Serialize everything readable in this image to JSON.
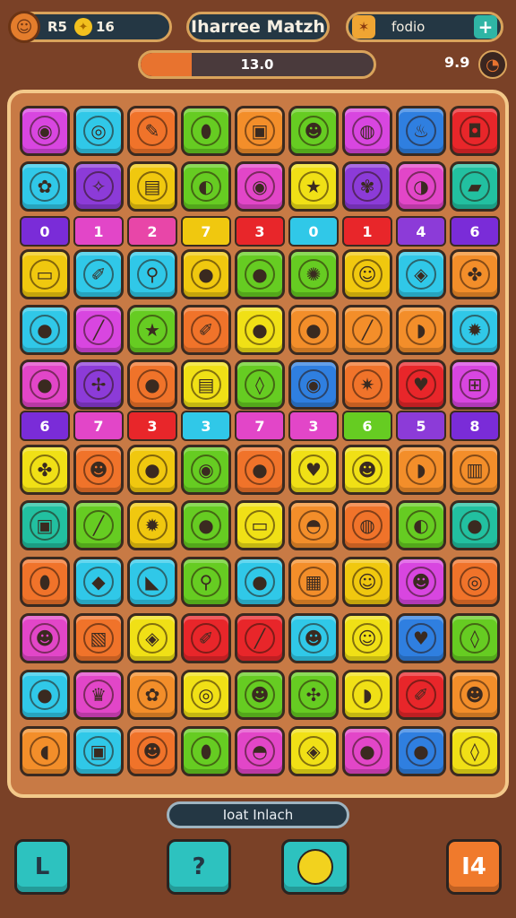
{
  "hud": {
    "left_label": "R5",
    "coins": "16",
    "title": "Iharree Matzh",
    "right_label": "fodio",
    "side_value": "9.9"
  },
  "progress": {
    "text": "13.0",
    "fraction": 0.22
  },
  "bottom_label": "Ioat Inlach",
  "buttons": {
    "a": "L",
    "b": "?",
    "d": "I4"
  },
  "board": {
    "rows": [
      {
        "kind": "tiles",
        "tiles": [
          {
            "c": "#d846e0",
            "g": "◉"
          },
          {
            "c": "#30c8e8",
            "g": "◎"
          },
          {
            "c": "#f0732a",
            "g": "✎"
          },
          {
            "c": "#66cc22",
            "g": "⬮"
          },
          {
            "c": "#f38e2a",
            "g": "▣"
          },
          {
            "c": "#66cc22",
            "g": "☻"
          },
          {
            "c": "#d846e0",
            "g": "◍"
          },
          {
            "c": "#2f7fe0",
            "g": "♨"
          },
          {
            "c": "#e8262a",
            "g": "◘"
          }
        ]
      },
      {
        "kind": "tiles",
        "tiles": [
          {
            "c": "#30c8e8",
            "g": "✿"
          },
          {
            "c": "#8c3bd8",
            "g": "✧"
          },
          {
            "c": "#f0c80f",
            "g": "▤"
          },
          {
            "c": "#66cc22",
            "g": "◐"
          },
          {
            "c": "#e246c8",
            "g": "◉"
          },
          {
            "c": "#f0e016",
            "g": "★"
          },
          {
            "c": "#8c3bd8",
            "g": "✾"
          },
          {
            "c": "#e246c8",
            "g": "◑"
          },
          {
            "c": "#22c0a0",
            "g": "▰"
          }
        ]
      },
      {
        "kind": "nums",
        "tiles": [
          {
            "c": "#7a2cd8",
            "n": "0"
          },
          {
            "c": "#e246c8",
            "n": "1"
          },
          {
            "c": "#e846a8",
            "n": "2"
          },
          {
            "c": "#f0c80f",
            "n": "7"
          },
          {
            "c": "#e8262a",
            "n": "3"
          },
          {
            "c": "#30c8e8",
            "n": "0"
          },
          {
            "c": "#e8262a",
            "n": "1"
          },
          {
            "c": "#8c3bd8",
            "n": "4"
          },
          {
            "c": "#7a2cd8",
            "n": "6"
          }
        ]
      },
      {
        "kind": "tiles",
        "tiles": [
          {
            "c": "#f0c80f",
            "g": "▭"
          },
          {
            "c": "#30c8e8",
            "g": "✐"
          },
          {
            "c": "#30c8e8",
            "g": "⚲"
          },
          {
            "c": "#f0c80f",
            "g": "●"
          },
          {
            "c": "#66cc22",
            "g": "●"
          },
          {
            "c": "#66cc22",
            "g": "✺"
          },
          {
            "c": "#f0c80f",
            "g": "☺"
          },
          {
            "c": "#30c8e8",
            "g": "◈"
          },
          {
            "c": "#f38e2a",
            "g": "✤"
          }
        ]
      },
      {
        "kind": "tiles",
        "tiles": [
          {
            "c": "#30c8e8",
            "g": "●"
          },
          {
            "c": "#d846e0",
            "g": "╱"
          },
          {
            "c": "#66cc22",
            "g": "★"
          },
          {
            "c": "#f0732a",
            "g": "✐"
          },
          {
            "c": "#f0e016",
            "g": "●"
          },
          {
            "c": "#f38e2a",
            "g": "●"
          },
          {
            "c": "#f38e2a",
            "g": "╱"
          },
          {
            "c": "#f38e2a",
            "g": "◗"
          },
          {
            "c": "#30c8e8",
            "g": "✹"
          }
        ]
      },
      {
        "kind": "tiles",
        "tiles": [
          {
            "c": "#e246c8",
            "g": "●"
          },
          {
            "c": "#8c3bd8",
            "g": "✢"
          },
          {
            "c": "#f0732a",
            "g": "●"
          },
          {
            "c": "#f0e016",
            "g": "▤"
          },
          {
            "c": "#66cc22",
            "g": "◊"
          },
          {
            "c": "#2f7fe0",
            "g": "◉"
          },
          {
            "c": "#f0732a",
            "g": "✷"
          },
          {
            "c": "#e8262a",
            "g": "♥"
          },
          {
            "c": "#d846e0",
            "g": "⊞"
          }
        ]
      },
      {
        "kind": "nums",
        "tiles": [
          {
            "c": "#7a2cd8",
            "n": "6"
          },
          {
            "c": "#e246c8",
            "n": "7"
          },
          {
            "c": "#e8262a",
            "n": "3"
          },
          {
            "c": "#30c8e8",
            "n": "3"
          },
          {
            "c": "#e246c8",
            "n": "7"
          },
          {
            "c": "#e246c8",
            "n": "3"
          },
          {
            "c": "#66cc22",
            "n": "6"
          },
          {
            "c": "#8c3bd8",
            "n": "5"
          },
          {
            "c": "#7a2cd8",
            "n": "8"
          }
        ]
      },
      {
        "kind": "tiles",
        "tiles": [
          {
            "c": "#f0e016",
            "g": "✤"
          },
          {
            "c": "#f0732a",
            "g": "☻"
          },
          {
            "c": "#f0c80f",
            "g": "●"
          },
          {
            "c": "#66cc22",
            "g": "◉"
          },
          {
            "c": "#f0732a",
            "g": "●"
          },
          {
            "c": "#f0e016",
            "g": "♥"
          },
          {
            "c": "#f0e016",
            "g": "☻"
          },
          {
            "c": "#f38e2a",
            "g": "◗"
          },
          {
            "c": "#f38e2a",
            "g": "▥"
          }
        ]
      },
      {
        "kind": "tiles",
        "tiles": [
          {
            "c": "#22c0a0",
            "g": "▣"
          },
          {
            "c": "#66cc22",
            "g": "╱"
          },
          {
            "c": "#f0c80f",
            "g": "✹"
          },
          {
            "c": "#66cc22",
            "g": "●"
          },
          {
            "c": "#f0e016",
            "g": "▭"
          },
          {
            "c": "#f38e2a",
            "g": "◓"
          },
          {
            "c": "#f0732a",
            "g": "◍"
          },
          {
            "c": "#66cc22",
            "g": "◐"
          },
          {
            "c": "#22c0a0",
            "g": "●"
          }
        ]
      },
      {
        "kind": "tiles",
        "tiles": [
          {
            "c": "#f0732a",
            "g": "⬮"
          },
          {
            "c": "#30c8e8",
            "g": "◆"
          },
          {
            "c": "#30c8e8",
            "g": "◣"
          },
          {
            "c": "#66cc22",
            "g": "⚲"
          },
          {
            "c": "#30c8e8",
            "g": "●"
          },
          {
            "c": "#f38e2a",
            "g": "▦"
          },
          {
            "c": "#f0c80f",
            "g": "☺"
          },
          {
            "c": "#d846e0",
            "g": "☻"
          },
          {
            "c": "#f0732a",
            "g": "◎"
          }
        ]
      },
      {
        "kind": "tiles",
        "tiles": [
          {
            "c": "#e246c8",
            "g": "☻"
          },
          {
            "c": "#f0732a",
            "g": "▧"
          },
          {
            "c": "#f0e016",
            "g": "◈"
          },
          {
            "c": "#e8262a",
            "g": "✐"
          },
          {
            "c": "#e8262a",
            "g": "╱"
          },
          {
            "c": "#30c8e8",
            "g": "☻"
          },
          {
            "c": "#f0e016",
            "g": "☺"
          },
          {
            "c": "#2f7fe0",
            "g": "♥"
          },
          {
            "c": "#66cc22",
            "g": "◊"
          }
        ]
      },
      {
        "kind": "tiles",
        "tiles": [
          {
            "c": "#30c8e8",
            "g": "●"
          },
          {
            "c": "#e246c8",
            "g": "♛"
          },
          {
            "c": "#f38e2a",
            "g": "✿"
          },
          {
            "c": "#f0e016",
            "g": "◎"
          },
          {
            "c": "#66cc22",
            "g": "☻"
          },
          {
            "c": "#66cc22",
            "g": "✣"
          },
          {
            "c": "#f0e016",
            "g": "◗"
          },
          {
            "c": "#e8262a",
            "g": "✐"
          },
          {
            "c": "#f38e2a",
            "g": "☻"
          }
        ]
      },
      {
        "kind": "tiles",
        "tiles": [
          {
            "c": "#f38e2a",
            "g": "◖"
          },
          {
            "c": "#30c8e8",
            "g": "▣"
          },
          {
            "c": "#f0732a",
            "g": "☻"
          },
          {
            "c": "#66cc22",
            "g": "⬮"
          },
          {
            "c": "#e246c8",
            "g": "◓"
          },
          {
            "c": "#f0e016",
            "g": "◈"
          },
          {
            "c": "#e246c8",
            "g": "●"
          },
          {
            "c": "#2f7fe0",
            "g": "●"
          },
          {
            "c": "#f0e016",
            "g": "◊"
          }
        ]
      }
    ]
  }
}
